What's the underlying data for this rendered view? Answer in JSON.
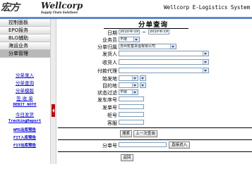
{
  "header": {
    "logo_mark": "宏方",
    "logo_text": "Wellcorp",
    "logo_sub": "Supply Chain Solutions",
    "system_title": "Wellcorp E-Logistics System"
  },
  "sidebar": {
    "categories": [
      "控制面板",
      "EPO报务",
      "BLG辅助",
      "海运业务",
      "分单管理"
    ],
    "links": [
      "分单录入",
      "分单查询",
      "分单模版",
      "签 收 单",
      "DEBIT NOTE",
      "今日发货",
      "TrackingReport",
      "WMS出库预告",
      "FIT入库预告",
      "FIT出库预告"
    ]
  },
  "form": {
    "title": "分单查询",
    "date_label": "日期",
    "date_from": "2010-6-19",
    "date_sep": "~",
    "date_to": "2010-6-19",
    "biz_type_label": "业务员",
    "biz_type_value": "不限",
    "belong_label": "分单归属",
    "belong_value": "苏州宏基货运有限公司",
    "shipper_label": "发货人",
    "consignee_label": "收货人",
    "payer_label": "付款代理",
    "origin_label": "始发地",
    "dest_label": "目的地",
    "status_label": "状态过滤",
    "status_value": "不限",
    "shipno_label": "发车序号",
    "sendno_label": "发单号",
    "cabinet_label": "柜号",
    "customer_label": "客服",
    "search_button": "搜索",
    "prev_button": "上一次查询",
    "fen_label": "分单号",
    "direct_button": "直接进入",
    "back_button": "返回"
  }
}
